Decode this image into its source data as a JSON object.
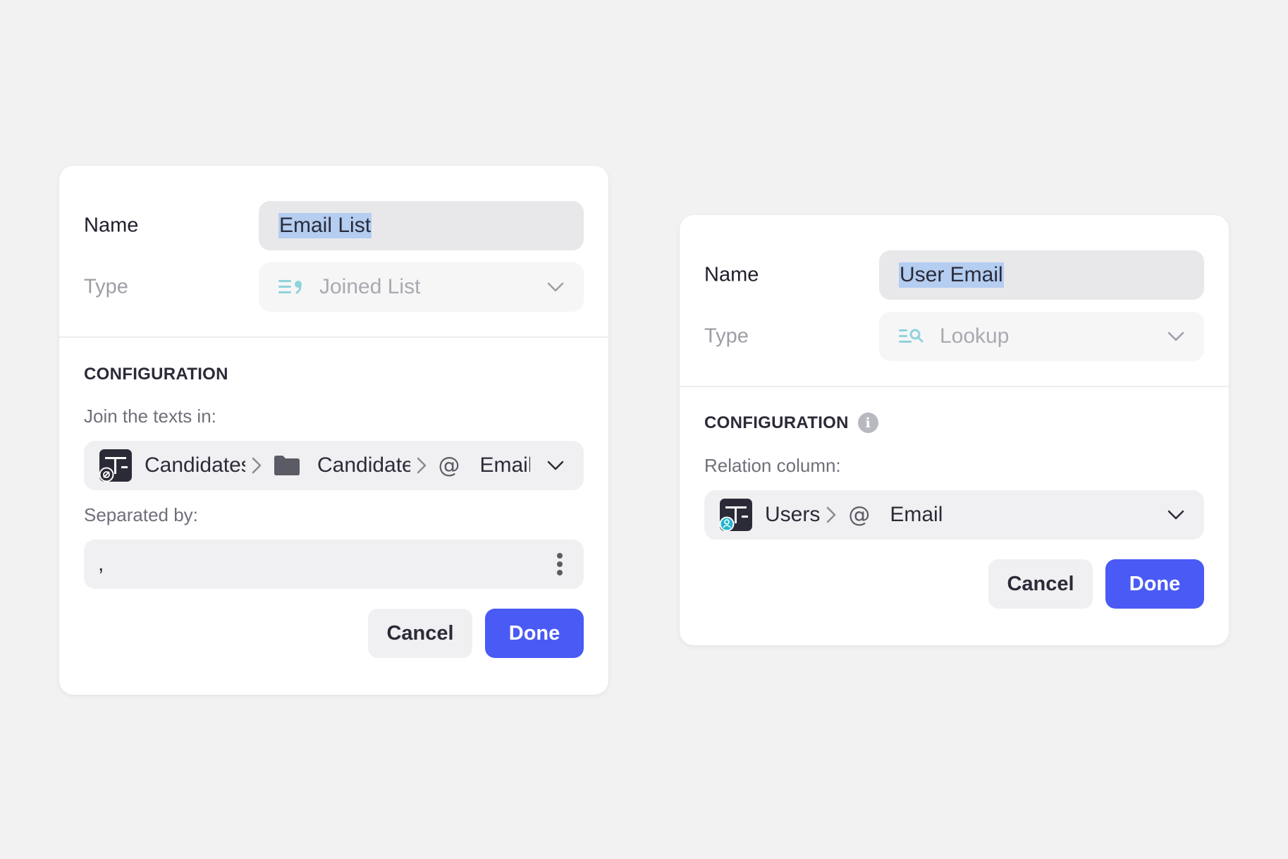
{
  "left_panel": {
    "name_label": "Name",
    "name_value": "Email List",
    "type_label": "Type",
    "type_value": "Joined List",
    "type_icon": "joined-list-icon",
    "section_title": "CONFIGURATION",
    "join_label": "Join the texts in:",
    "join_path": {
      "table": "Candidates",
      "field_group": "Candidate",
      "column": "Email"
    },
    "separator_label": "Separated by:",
    "separator_value": ",",
    "cancel_label": "Cancel",
    "done_label": "Done"
  },
  "right_panel": {
    "name_label": "Name",
    "name_value": "User Email",
    "type_label": "Type",
    "type_value": "Lookup",
    "type_icon": "lookup-icon",
    "section_title": "CONFIGURATION",
    "relation_label": "Relation column:",
    "relation_path": {
      "table": "Users",
      "column": "Email"
    },
    "cancel_label": "Cancel",
    "done_label": "Done"
  },
  "colors": {
    "primary": "#4a5af5",
    "selection": "#b4cdf1",
    "type_icon_teal": "#8fd3dc",
    "background": "#f2f2f3"
  }
}
